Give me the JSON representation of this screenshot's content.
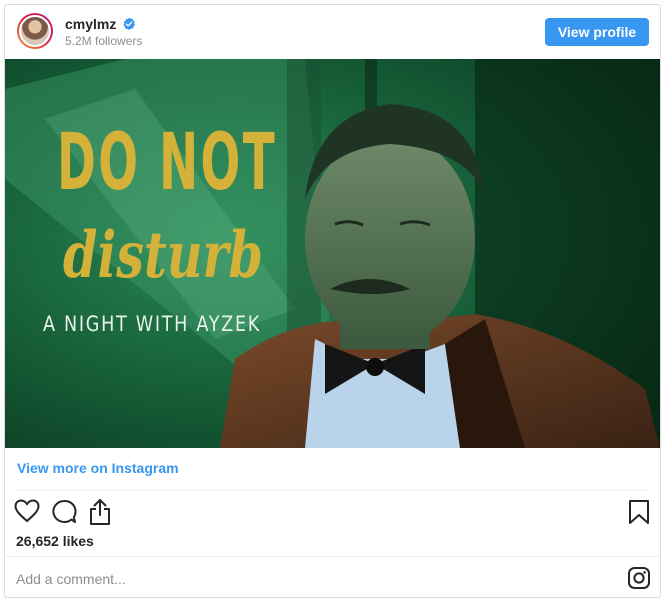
{
  "profile": {
    "username": "cmylmz",
    "followers": "5.2M followers",
    "view_profile_label": "View profile"
  },
  "post": {
    "title_line1": "DO NOT",
    "title_line2": "disturb",
    "subtitle": "A NIGHT WITH AYZEK"
  },
  "view_more_label": "View more on Instagram",
  "likes_text": "26,652 likes",
  "comment_placeholder": "Add a comment...",
  "icons": {
    "verified": "verified-badge-icon",
    "like": "heart-icon",
    "comment": "comment-icon",
    "share": "share-icon",
    "save": "bookmark-icon",
    "brand": "instagram-icon"
  },
  "colors": {
    "accent": "#3897f0",
    "title_gold": "#d4b23a",
    "image_green": "#0f3a22"
  }
}
